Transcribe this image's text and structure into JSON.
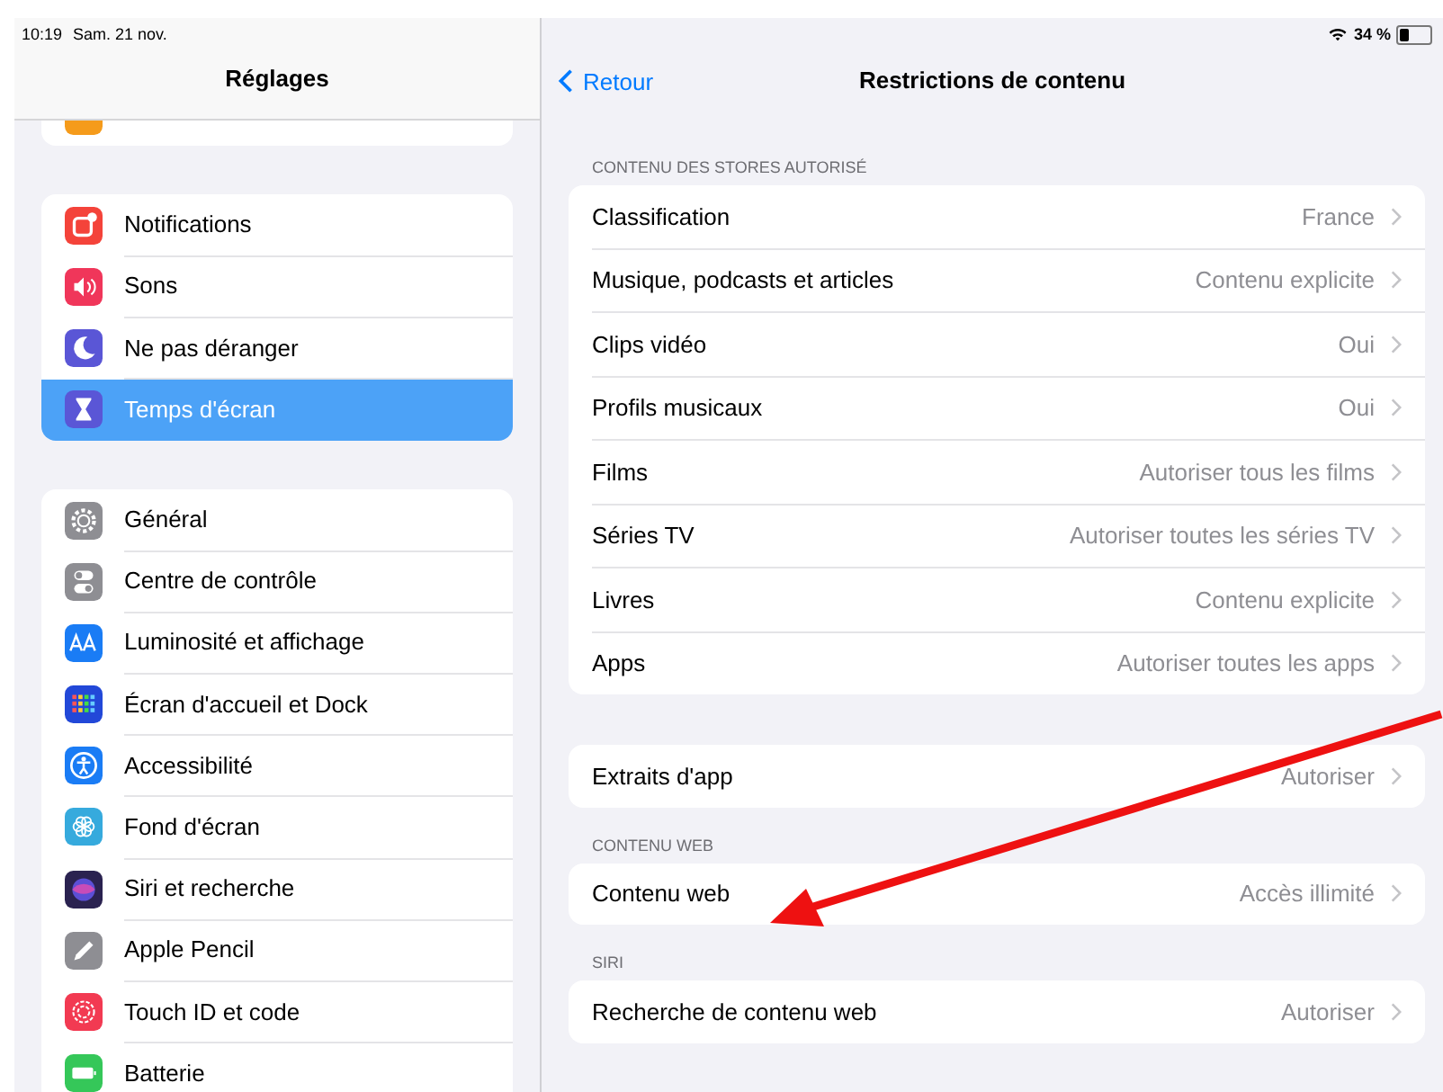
{
  "status_bar": {
    "time": "10:19",
    "date": "Sam. 21 nov.",
    "battery_percent": "34 %"
  },
  "sidebar": {
    "title": "Réglages",
    "groups": [
      {
        "items": [
          {
            "label": "Notifications",
            "selected": false
          },
          {
            "label": "Sons",
            "selected": false
          },
          {
            "label": "Ne pas déranger",
            "selected": false
          },
          {
            "label": "Temps d'écran",
            "selected": true
          }
        ]
      },
      {
        "items": [
          {
            "label": "Général",
            "selected": false
          },
          {
            "label": "Centre de contrôle",
            "selected": false
          },
          {
            "label": "Luminosité et affichage",
            "selected": false
          },
          {
            "label": "Écran d'accueil et Dock",
            "selected": false
          },
          {
            "label": "Accessibilité",
            "selected": false
          },
          {
            "label": "Fond d'écran",
            "selected": false
          },
          {
            "label": "Siri et recherche",
            "selected": false
          },
          {
            "label": "Apple Pencil",
            "selected": false
          },
          {
            "label": "Touch ID et code",
            "selected": false
          },
          {
            "label": "Batterie",
            "selected": false
          }
        ]
      }
    ]
  },
  "detail": {
    "back": "Retour",
    "title": "Restrictions de contenu",
    "sections": [
      {
        "header": "CONTENU DES STORES AUTORISÉ",
        "rows": [
          {
            "label": "Classification",
            "value": "France"
          },
          {
            "label": "Musique, podcasts et articles",
            "value": "Contenu explicite"
          },
          {
            "label": "Clips vidéo",
            "value": "Oui"
          },
          {
            "label": "Profils musicaux",
            "value": "Oui"
          },
          {
            "label": "Films",
            "value": "Autoriser tous les films"
          },
          {
            "label": "Séries TV",
            "value": "Autoriser toutes les séries TV"
          },
          {
            "label": "Livres",
            "value": "Contenu explicite"
          },
          {
            "label": "Apps",
            "value": "Autoriser toutes les apps"
          }
        ]
      },
      {
        "rows": [
          {
            "label": "Extraits d'app",
            "value": "Autoriser"
          }
        ]
      },
      {
        "header": "CONTENU WEB",
        "rows": [
          {
            "label": "Contenu web",
            "value": "Accès illimité"
          }
        ]
      },
      {
        "header": "SIRI",
        "rows": [
          {
            "label": "Recherche de contenu web",
            "value": "Autoriser"
          }
        ]
      }
    ]
  },
  "annotation": {
    "kind": "arrow"
  }
}
